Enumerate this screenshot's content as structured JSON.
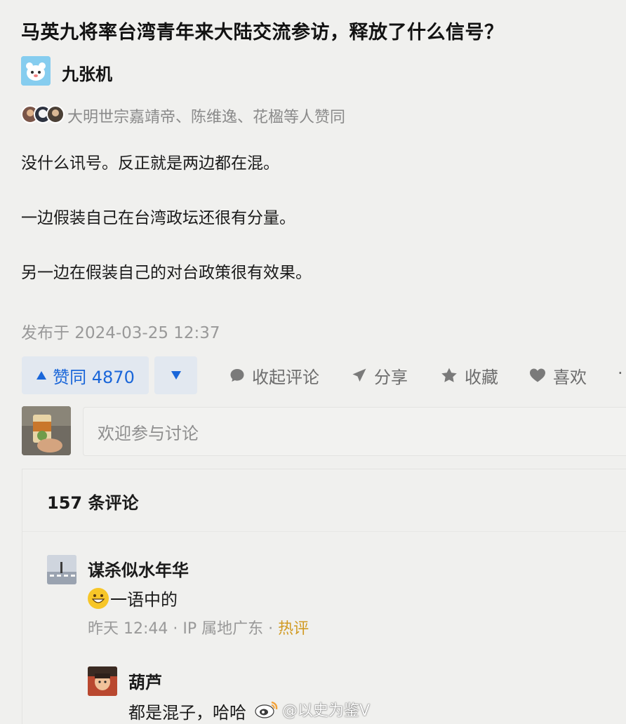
{
  "question": {
    "title": "马英九将率台湾青年来大陆交流参访，释放了什么信号？"
  },
  "author": {
    "name": "九张机",
    "avatar_icon": "cartoon-bear-avatar"
  },
  "voters": {
    "text": "大明世宗嘉靖帝、陈维逸、花楹等人赞同"
  },
  "answer": {
    "paragraphs": [
      "没什么讯号。反正就是两边都在混。",
      "一边假装自己在台湾政坛还很有分量。",
      "另一边在假装自己的对台政策很有效果。"
    ],
    "published": "发布于 2024-03-25 12:37"
  },
  "actions": {
    "upvote_label": "赞同 4870",
    "collapse_comments": "收起评论",
    "share": "分享",
    "favorite": "收藏",
    "like": "喜欢",
    "more": "·",
    "accent": "#1a66d9"
  },
  "comment_box": {
    "placeholder": "欢迎参与讨论"
  },
  "comments": {
    "count_label": "157 条评论",
    "items": [
      {
        "user": "谋杀似水年华",
        "text": "一语中的",
        "emoji": "grinning-face-emoji",
        "time": "昨天 12:44",
        "ip": "IP 属地广东",
        "tag": "热评"
      },
      {
        "user": "葫芦",
        "text": "都是混子，哈哈"
      }
    ]
  },
  "watermark": {
    "text": "@以史为鉴V",
    "icon": "weibo-logo"
  }
}
